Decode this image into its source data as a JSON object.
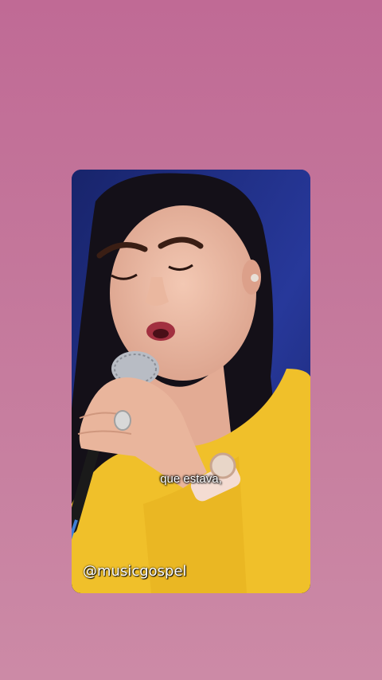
{
  "story": {
    "caption": "que estava,",
    "watermark": "@musicgospel"
  },
  "colors": {
    "background_top": "#c06a95",
    "background_bottom": "#cc8aa6",
    "video_backdrop": "#1d2b7a",
    "shirt": "#f0c02a"
  }
}
